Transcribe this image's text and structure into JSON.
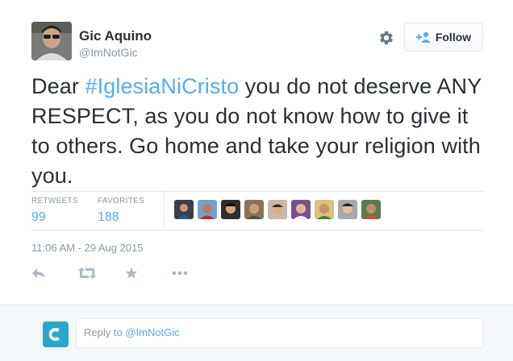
{
  "author": {
    "name": "Gic Aquino",
    "handle": "@ImNotGic"
  },
  "follow_button": {
    "label": "Follow"
  },
  "tweet": {
    "text_before": "Dear ",
    "hashtag": "#IglesiaNiCristo",
    "text_after": " you do not deserve ANY RESPECT, as you do not know how to give it to others. Go home and take your religion with you."
  },
  "stats": {
    "retweets_label": "RETWEETS",
    "retweets_value": "99",
    "favorites_label": "FAVORITES",
    "favorites_value": "188"
  },
  "favoriters_count_shown": 9,
  "timestamp": "11:06 AM - 29 Aug 2015",
  "actions": [
    "reply-icon",
    "retweet-icon",
    "favorite-icon",
    "more-icon"
  ],
  "reply": {
    "prefix": "Reply to ",
    "mention": "@ImNotGic"
  },
  "colors": {
    "accent": "#55acee",
    "text": "#292f33",
    "muted": "#8899a6",
    "border": "#e1e8ed",
    "reply_bg": "#f5f8fa"
  }
}
